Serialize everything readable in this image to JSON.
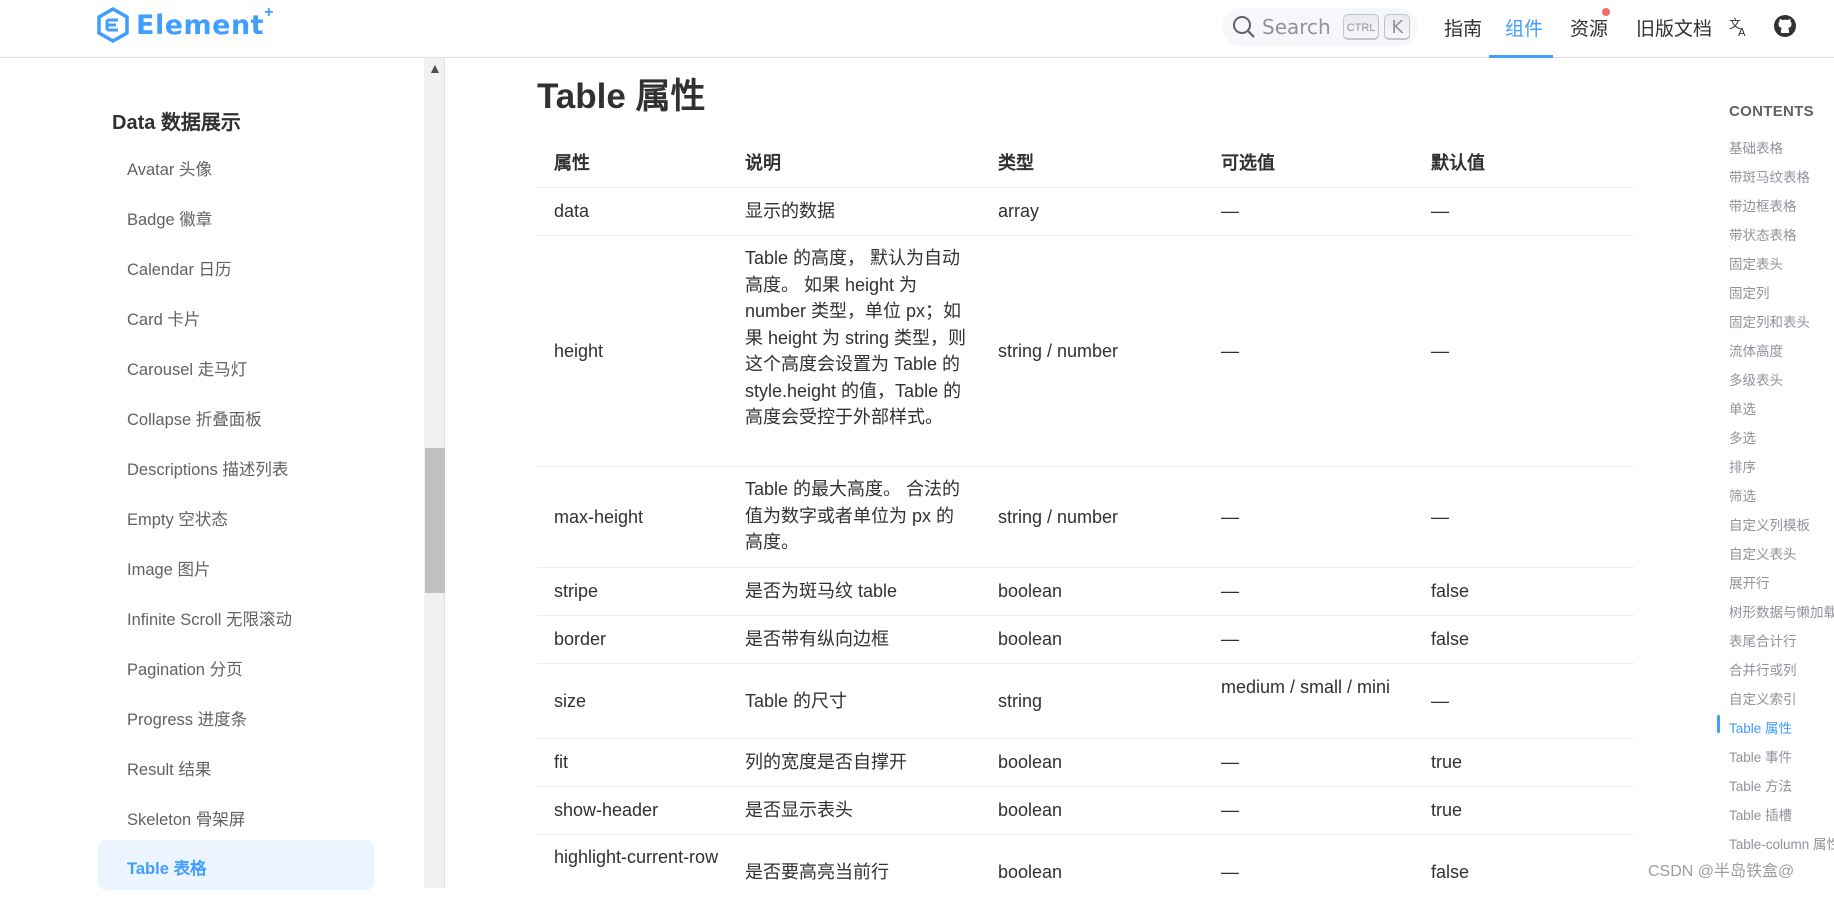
{
  "header": {
    "logo_text": "Element",
    "logo_plus": "+",
    "search_placeholder": "Search",
    "kbd_ctrl": "CTRL",
    "kbd_k": "K",
    "nav": [
      "指南",
      "组件",
      "资源",
      "旧版文档"
    ],
    "active_nav": "组件"
  },
  "sidebar": {
    "group_title": "Data 数据展示",
    "items": [
      "Avatar 头像",
      "Badge 徽章",
      "Calendar 日历",
      "Card 卡片",
      "Carousel 走马灯",
      "Collapse 折叠面板",
      "Descriptions 描述列表",
      "Empty 空状态",
      "Image 图片",
      "Infinite Scroll 无限滚动",
      "Pagination 分页",
      "Progress 进度条",
      "Result 结果",
      "Skeleton 骨架屏",
      "Table 表格"
    ],
    "active_item": "Table 表格"
  },
  "main": {
    "title": "Table 属性",
    "table": {
      "headers": [
        "属性",
        "说明",
        "类型",
        "可选值",
        "默认值"
      ],
      "rows": [
        [
          "data",
          "显示的数据",
          "array",
          "—",
          "—"
        ],
        [
          "height",
          "Table 的高度， 默认为自动高度。 如果 height 为 number 类型，单位 px；如果 height 为 string 类型，则这个高度会设置为 Table 的 style.height 的值，Table 的高度会受控于外部样式。",
          "string / number",
          "—",
          "—"
        ],
        [
          "max-height",
          "Table 的最大高度。 合法的值为数字或者单位为 px 的高度。",
          "string / number",
          "—",
          "—"
        ],
        [
          "stripe",
          "是否为斑马纹 table",
          "boolean",
          "—",
          "false"
        ],
        [
          "border",
          "是否带有纵向边框",
          "boolean",
          "—",
          "false"
        ],
        [
          "size",
          "Table 的尺寸",
          "string",
          "medium / small / mini",
          "—"
        ],
        [
          "fit",
          "列的宽度是否自撑开",
          "boolean",
          "—",
          "true"
        ],
        [
          "show-header",
          "是否显示表头",
          "boolean",
          "—",
          "true"
        ],
        [
          "highlight-current-row",
          "是否要高亮当前行",
          "boolean",
          "—",
          "false"
        ]
      ]
    }
  },
  "toc": {
    "title": "CONTENTS",
    "items": [
      "基础表格",
      "带斑马纹表格",
      "带边框表格",
      "带状态表格",
      "固定表头",
      "固定列",
      "固定列和表头",
      "流体高度",
      "多级表头",
      "单选",
      "多选",
      "排序",
      "筛选",
      "自定义列模板",
      "自定义表头",
      "展开行",
      "树形数据与懒加载",
      "表尾合计行",
      "合并行或列",
      "自定义索引",
      "Table 属性",
      "Table 事件",
      "Table 方法",
      "Table 插槽",
      "Table-column 属性"
    ],
    "active_item": "Table 属性"
  },
  "watermark": "CSDN @半岛铁盒@",
  "colors": {
    "accent": "#409eff",
    "text": "#303133",
    "muted": "#909399",
    "border": "#ebeef5"
  }
}
